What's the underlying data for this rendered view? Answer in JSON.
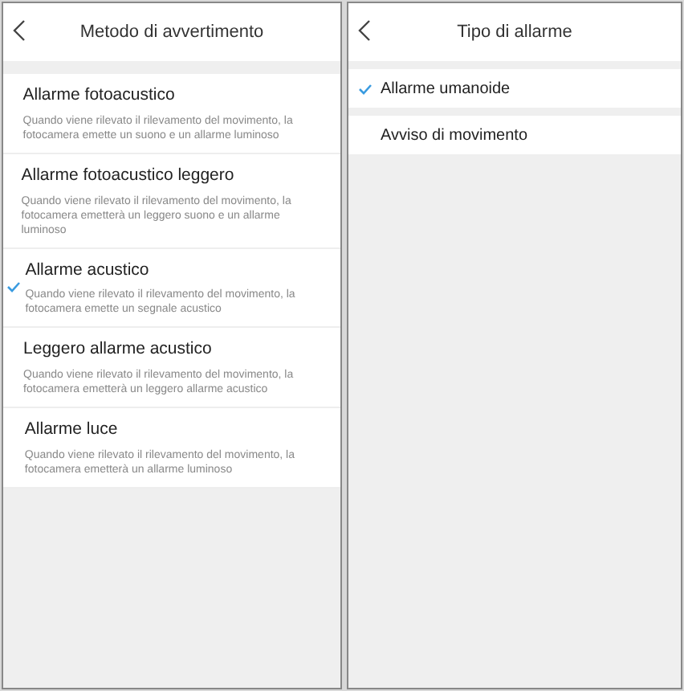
{
  "screens": [
    {
      "title": "Metodo di avvertimento",
      "options": [
        {
          "label": "Allarme fotoacustico",
          "description": "Quando viene rilevato il rilevamento del movimento, la fotocamera emette un suono e un allarme luminoso",
          "selected": false
        },
        {
          "label": "Allarme fotoacustico leggero",
          "description": "Quando viene rilevato il rilevamento del movimento, la fotocamera emetterà un leggero suono e un allarme luminoso",
          "selected": false
        },
        {
          "label": "Allarme acustico",
          "description": "Quando viene rilevato il rilevamento del movimento, la fotocamera emette un segnale acustico",
          "selected": true
        },
        {
          "label": "Leggero allarme acustico",
          "description": "Quando viene rilevato il rilevamento del movimento, la fotocamera emetterà un leggero allarme acustico",
          "selected": false
        },
        {
          "label": "Allarme luce",
          "description": "Quando viene rilevato il rilevamento del movimento, la fotocamera emetterà un allarme luminoso",
          "selected": false
        }
      ]
    },
    {
      "title": "Tipo di allarme",
      "options": [
        {
          "label": "Allarme umanoide",
          "selected": true
        },
        {
          "label": "Avviso di movimento",
          "selected": false
        }
      ]
    }
  ]
}
